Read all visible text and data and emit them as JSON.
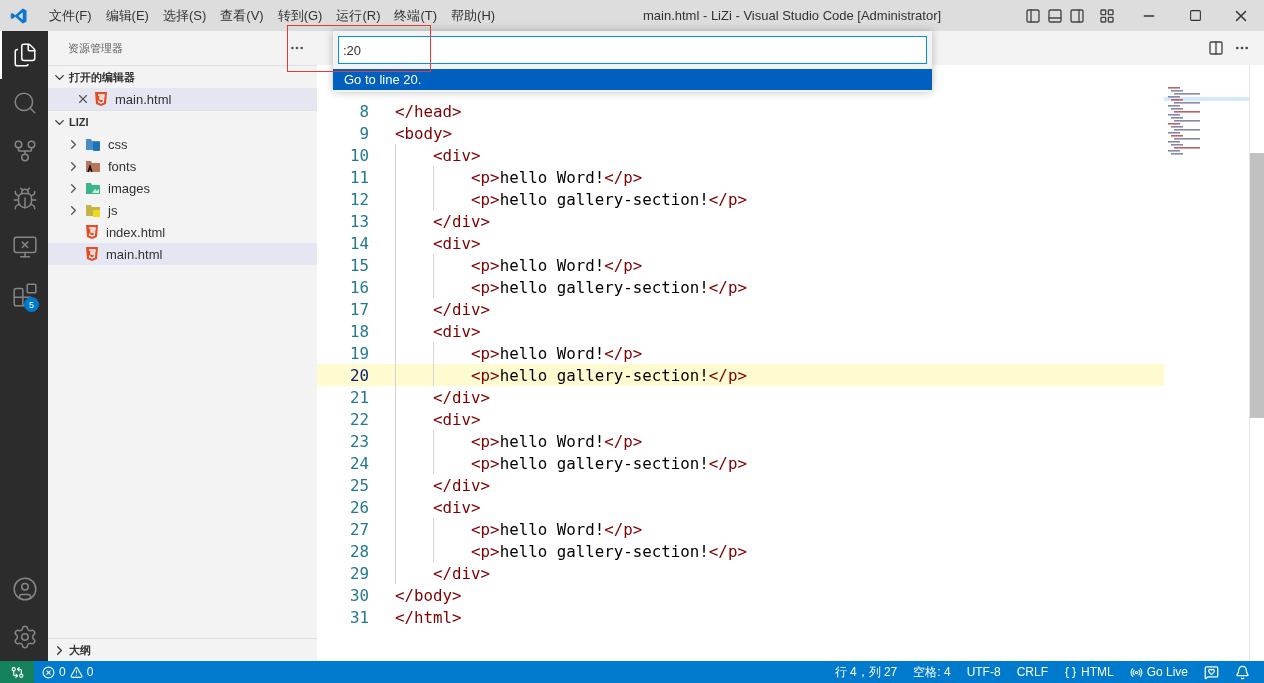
{
  "title_bar": {
    "menus": [
      "文件(F)",
      "编辑(E)",
      "选择(S)",
      "查看(V)",
      "转到(G)",
      "运行(R)",
      "终端(T)",
      "帮助(H)"
    ],
    "title": "main.html - LiZi - Visual Studio Code [Administrator]"
  },
  "activity_bar": {
    "items": [
      {
        "kind": "explorer",
        "selected": true
      },
      {
        "kind": "search",
        "selected": false
      },
      {
        "kind": "source-control",
        "selected": false
      },
      {
        "kind": "run-debug",
        "selected": false
      },
      {
        "kind": "remote",
        "selected": false
      },
      {
        "kind": "extensions",
        "selected": false,
        "badge": "5"
      }
    ],
    "bottom": [
      {
        "kind": "account"
      },
      {
        "kind": "settings"
      }
    ]
  },
  "sidebar": {
    "title": "资源管理器",
    "sections": [
      {
        "label": "打开的编辑器",
        "expanded": true,
        "items": [
          {
            "name": "main.html",
            "kind": "html",
            "selected": true,
            "closable": true
          }
        ]
      },
      {
        "label": "LIZI",
        "expanded": true,
        "items": [
          {
            "name": "css",
            "kind": "css-folder",
            "expanded": false,
            "selected": false
          },
          {
            "name": "fonts",
            "kind": "fonts-folder",
            "expanded": false,
            "selected": false
          },
          {
            "name": "images",
            "kind": "images-folder",
            "expanded": false,
            "selected": false
          },
          {
            "name": "js",
            "kind": "js-folder",
            "expanded": false,
            "selected": false
          },
          {
            "name": "index.html",
            "kind": "html",
            "selected": false
          },
          {
            "name": "main.html",
            "kind": "html",
            "selected": true
          }
        ]
      }
    ],
    "outline": {
      "label": "大纲",
      "expanded": false
    }
  },
  "quick_input": {
    "value": ":20",
    "items": [
      {
        "label": "Go to line 20.",
        "selected": true
      }
    ]
  },
  "annotations": [
    {
      "kind": "frame"
    }
  ],
  "editor": {
    "lines": [
      {
        "n": "8",
        "current": false,
        "segs": [
          {
            "kind": "tag",
            "text": "</head>"
          }
        ]
      },
      {
        "n": "9",
        "current": false,
        "segs": [
          {
            "kind": "tag",
            "text": "<body>"
          }
        ]
      },
      {
        "n": "10",
        "current": false,
        "segs": [
          {
            "kind": "tag",
            "text": "    <div>"
          }
        ]
      },
      {
        "n": "11",
        "current": false,
        "segs": [
          {
            "kind": "tag",
            "text": "        <p>"
          },
          {
            "kind": "plain",
            "text": "hello Word!"
          },
          {
            "kind": "tag",
            "text": "</p>"
          }
        ]
      },
      {
        "n": "12",
        "current": false,
        "segs": [
          {
            "kind": "tag",
            "text": "        <p>"
          },
          {
            "kind": "plain",
            "text": "hello gallery-section!"
          },
          {
            "kind": "tag",
            "text": "</p>"
          }
        ]
      },
      {
        "n": "13",
        "current": false,
        "segs": [
          {
            "kind": "tag",
            "text": "    </div>"
          }
        ]
      },
      {
        "n": "14",
        "current": false,
        "segs": [
          {
            "kind": "tag",
            "text": "    <div>"
          }
        ]
      },
      {
        "n": "15",
        "current": false,
        "segs": [
          {
            "kind": "tag",
            "text": "        <p>"
          },
          {
            "kind": "plain",
            "text": "hello Word!"
          },
          {
            "kind": "tag",
            "text": "</p>"
          }
        ]
      },
      {
        "n": "16",
        "current": false,
        "segs": [
          {
            "kind": "tag",
            "text": "        <p>"
          },
          {
            "kind": "plain",
            "text": "hello gallery-section!"
          },
          {
            "kind": "tag",
            "text": "</p>"
          }
        ]
      },
      {
        "n": "17",
        "current": false,
        "segs": [
          {
            "kind": "tag",
            "text": "    </div>"
          }
        ]
      },
      {
        "n": "18",
        "current": false,
        "segs": [
          {
            "kind": "tag",
            "text": "    <div>"
          }
        ]
      },
      {
        "n": "19",
        "current": false,
        "segs": [
          {
            "kind": "tag",
            "text": "        <p>"
          },
          {
            "kind": "plain",
            "text": "hello Word!"
          },
          {
            "kind": "tag",
            "text": "</p>"
          }
        ]
      },
      {
        "n": "20",
        "current": true,
        "segs": [
          {
            "kind": "tag",
            "text": "        <p>"
          },
          {
            "kind": "plain",
            "text": "hello gallery-section!"
          },
          {
            "kind": "tag",
            "text": "</p>"
          }
        ]
      },
      {
        "n": "21",
        "current": false,
        "segs": [
          {
            "kind": "tag",
            "text": "    </div>"
          }
        ]
      },
      {
        "n": "22",
        "current": false,
        "segs": [
          {
            "kind": "tag",
            "text": "    <div>"
          }
        ]
      },
      {
        "n": "23",
        "current": false,
        "segs": [
          {
            "kind": "tag",
            "text": "        <p>"
          },
          {
            "kind": "plain",
            "text": "hello Word!"
          },
          {
            "kind": "tag",
            "text": "</p>"
          }
        ]
      },
      {
        "n": "24",
        "current": false,
        "segs": [
          {
            "kind": "tag",
            "text": "        <p>"
          },
          {
            "kind": "plain",
            "text": "hello gallery-section!"
          },
          {
            "kind": "tag",
            "text": "</p>"
          }
        ]
      },
      {
        "n": "25",
        "current": false,
        "segs": [
          {
            "kind": "tag",
            "text": "    </div>"
          }
        ]
      },
      {
        "n": "26",
        "current": false,
        "segs": [
          {
            "kind": "tag",
            "text": "    <div>"
          }
        ]
      },
      {
        "n": "27",
        "current": false,
        "segs": [
          {
            "kind": "tag",
            "text": "        <p>"
          },
          {
            "kind": "plain",
            "text": "hello Word!"
          },
          {
            "kind": "tag",
            "text": "</p>"
          }
        ]
      },
      {
        "n": "28",
        "current": false,
        "segs": [
          {
            "kind": "tag",
            "text": "        <p>"
          },
          {
            "kind": "plain",
            "text": "hello gallery-section!"
          },
          {
            "kind": "tag",
            "text": "</p>"
          }
        ]
      },
      {
        "n": "29",
        "current": false,
        "segs": [
          {
            "kind": "tag",
            "text": "    </div>"
          }
        ]
      },
      {
        "n": "30",
        "current": false,
        "segs": [
          {
            "kind": "tag",
            "text": "</body>"
          }
        ]
      },
      {
        "n": "31",
        "current": false,
        "segs": [
          {
            "kind": "tag",
            "text": "</html>"
          }
        ]
      }
    ]
  },
  "status_bar": {
    "errors": "0",
    "warnings": "0",
    "items": [
      {
        "kind": "text",
        "text": "行 4，列 27"
      },
      {
        "kind": "text",
        "text": "空格: 4"
      },
      {
        "kind": "text",
        "text": "UTF-8"
      },
      {
        "kind": "text",
        "text": "CRLF"
      },
      {
        "kind": "language",
        "text": "HTML"
      },
      {
        "kind": "live",
        "text": "Go Live"
      },
      {
        "kind": "feedback"
      },
      {
        "kind": "bell"
      }
    ]
  }
}
